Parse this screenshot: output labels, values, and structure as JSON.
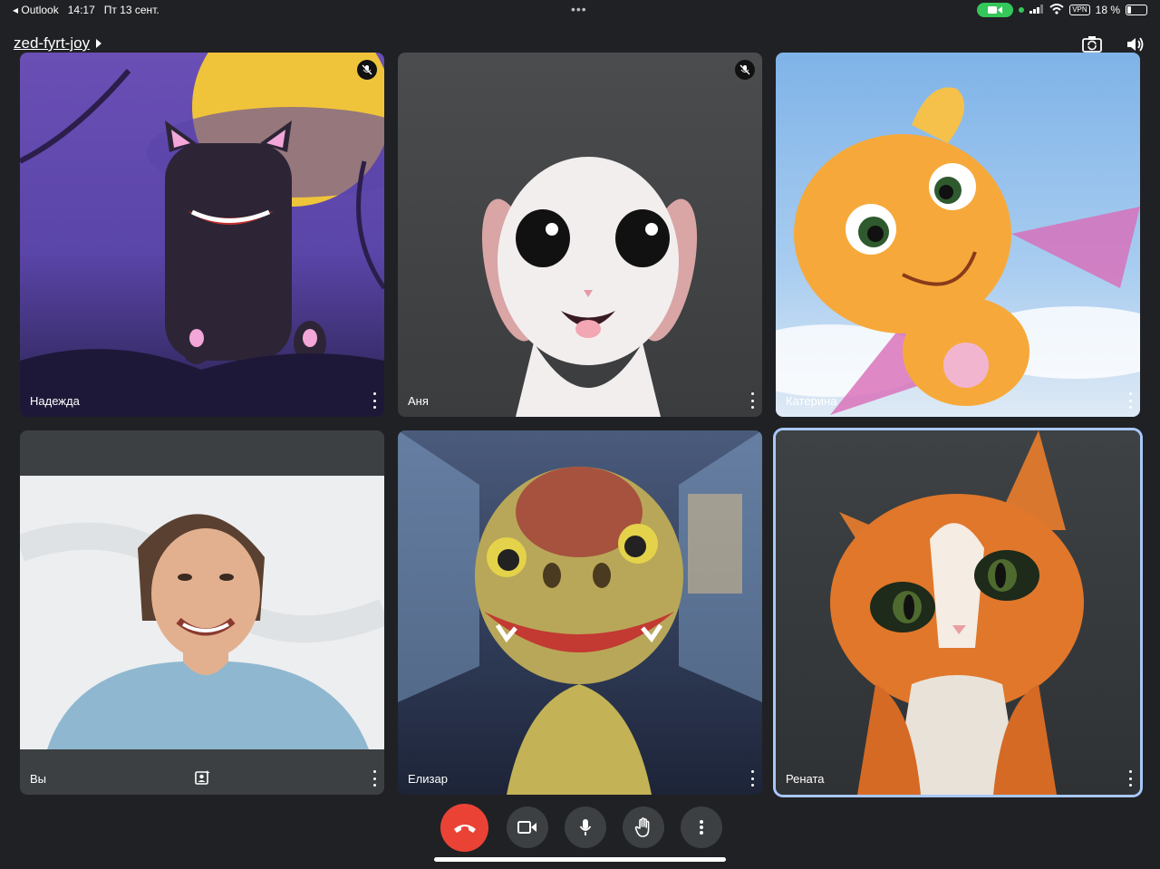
{
  "status_bar": {
    "back_app": "Outlook",
    "time": "14:17",
    "date": "Пт 13 сент.",
    "vpn": "VPN",
    "battery": "18 %"
  },
  "header": {
    "meeting_code": "zed-fyrt-joy"
  },
  "tiles": [
    {
      "name": "Надежда",
      "muted": true
    },
    {
      "name": "Аня",
      "muted": true
    },
    {
      "name": "Катерина",
      "muted": false
    },
    {
      "name": "Вы",
      "muted": false
    },
    {
      "name": "Елизар",
      "muted": false
    },
    {
      "name": "Рената",
      "muted": false,
      "active_speaker": true
    }
  ],
  "controls": [
    "end-call",
    "camera",
    "microphone",
    "raise-hand",
    "more-options"
  ],
  "colors": {
    "background": "#202124",
    "end_call": "#ea4335",
    "active_border": "#a8c7fa",
    "status_green": "#34c759"
  }
}
